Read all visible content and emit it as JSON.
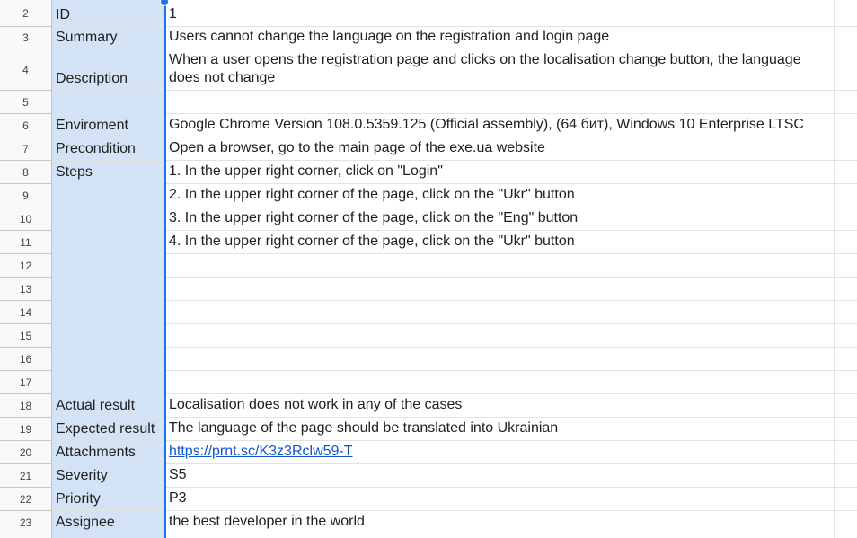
{
  "sheet": {
    "rows": [
      {
        "num": "2",
        "label": "ID",
        "value": "1"
      },
      {
        "num": "3",
        "label": "Summary",
        "value": "Users cannot change the language on the registration and login page"
      },
      {
        "num": "4",
        "label": "Description",
        "value": "When a user opens the registration page and clicks on the localisation change button, the language does not change"
      },
      {
        "num": "5",
        "label": "",
        "value": ""
      },
      {
        "num": "6",
        "label": "Enviroment",
        "value": "Google Chrome Version 108.0.5359.125 (Official assembly), (64 бит), Windows 10 Enterprise LTSC"
      },
      {
        "num": "7",
        "label": "Precondition",
        "value": "Open a browser, go to the main page of the exe.ua website"
      },
      {
        "num": "8",
        "label": "Steps",
        "value": "1. In the upper right corner, click on \"Login\""
      },
      {
        "num": "9",
        "label": "",
        "value": "2. In the upper right corner of the page, click on the \"Ukr\" button"
      },
      {
        "num": "10",
        "label": "",
        "value": "3. In the upper right corner of the page, click on the \"Eng\" button"
      },
      {
        "num": "11",
        "label": "",
        "value": "4. In the upper right corner of the page, click on the \"Ukr\" button"
      },
      {
        "num": "12",
        "label": "",
        "value": ""
      },
      {
        "num": "13",
        "label": "",
        "value": ""
      },
      {
        "num": "14",
        "label": "",
        "value": ""
      },
      {
        "num": "15",
        "label": "",
        "value": ""
      },
      {
        "num": "16",
        "label": "",
        "value": ""
      },
      {
        "num": "17",
        "label": "",
        "value": ""
      },
      {
        "num": "18",
        "label": "Actual result",
        "value": "Localisation does not work in any of the cases"
      },
      {
        "num": "19",
        "label": "Expected result",
        "value": "The language of the page should be translated into Ukrainian"
      },
      {
        "num": "20",
        "label": "Attachments",
        "value": "https://prnt.sc/K3z3Rclw59-T"
      },
      {
        "num": "21",
        "label": "Severity",
        "value": "S5"
      },
      {
        "num": "22",
        "label": "Priority",
        "value": "P3"
      },
      {
        "num": "23",
        "label": "Assignee",
        "value": "the best developer in the world"
      }
    ]
  },
  "colors": {
    "selected_column": "#d3e3f5",
    "selection_border": "#1a73e8",
    "link": "#1155cc",
    "row_header_bg": "#f8f9fa"
  }
}
